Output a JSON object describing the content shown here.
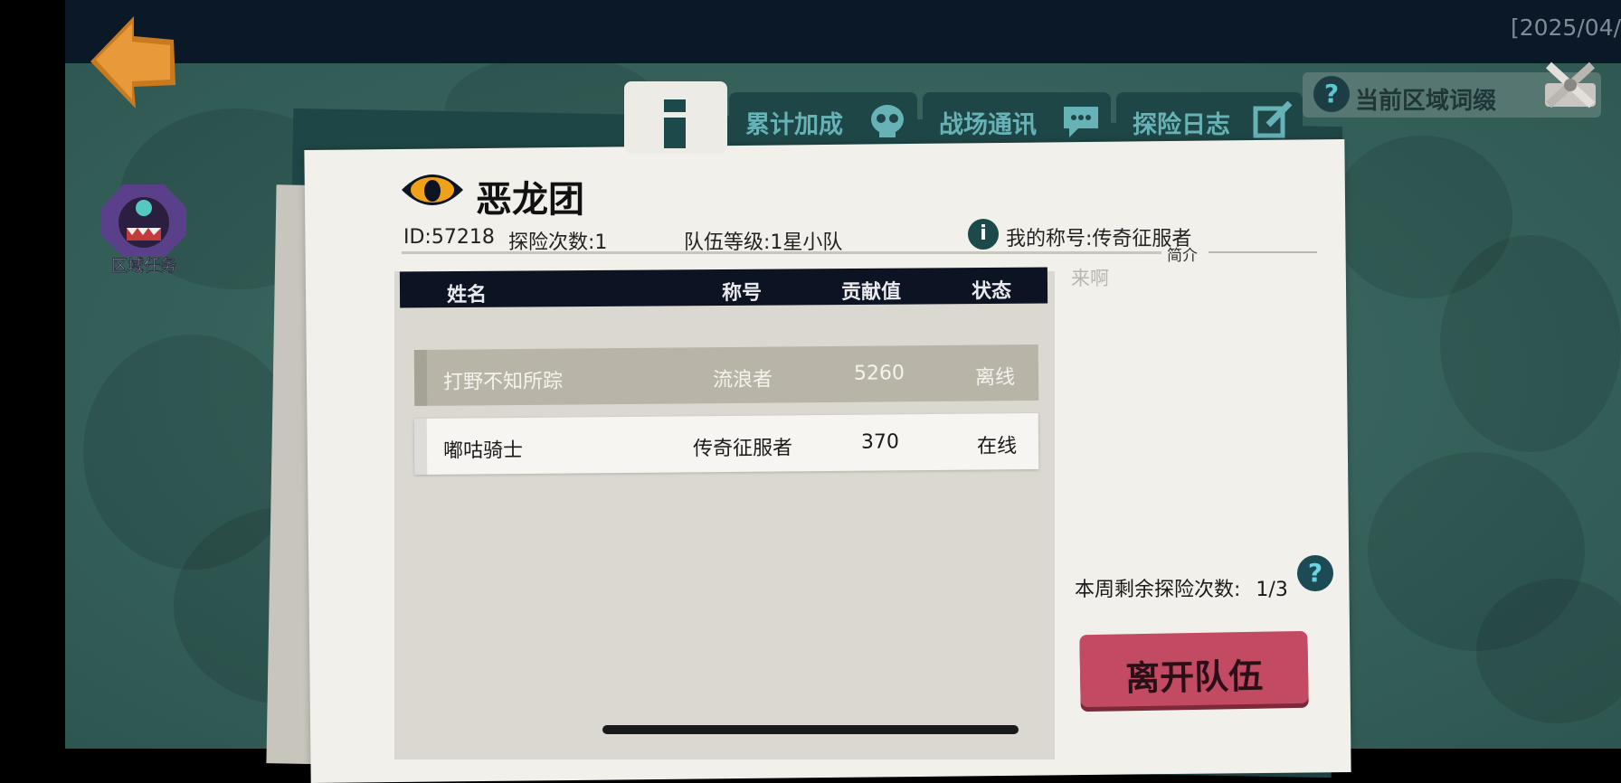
{
  "topbar": {
    "date": "[2025/04/"
  },
  "side": {
    "quest_label": "区域任务"
  },
  "region": {
    "label": "当前区域词缀",
    "help": "?"
  },
  "tabs": [
    {
      "label": "累计加成"
    },
    {
      "label": "战场通讯"
    },
    {
      "label": "探险日志"
    }
  ],
  "team": {
    "name": "恶龙团",
    "id_text": "ID:57218",
    "explore_count": "探险次数:1",
    "level": "队伍等级:1星小队",
    "my_title": "我的称号:传奇征服者",
    "intro_label": "简介",
    "intro_text": "来啊"
  },
  "table": {
    "headers": {
      "name": "姓名",
      "title": "称号",
      "contribution": "贡献值",
      "status": "状态"
    },
    "rows": [
      {
        "name": "打野不知所踪",
        "title": "流浪者",
        "contribution": "5260",
        "status": "离线"
      },
      {
        "name": "嘟咕骑士",
        "title": "传奇征服者",
        "contribution": "370",
        "status": "在线"
      }
    ]
  },
  "weekly": {
    "label": "本周剩余探险次数:",
    "value": "1/3",
    "help": "?"
  },
  "buttons": {
    "leave": "离开队伍"
  },
  "colors": {
    "background": "#35605a",
    "topbar": "#0b1827",
    "tab": "#1f4646",
    "tab_text": "#66b2b6",
    "leave_button": "#c24a63"
  },
  "icons": [
    "back-arrow-icon",
    "region-quest-icon",
    "help-icon",
    "crossed-swords-icon",
    "info-icon",
    "skull-icon",
    "chat-bubble-icon",
    "edit-log-icon",
    "eye-logo-icon"
  ]
}
